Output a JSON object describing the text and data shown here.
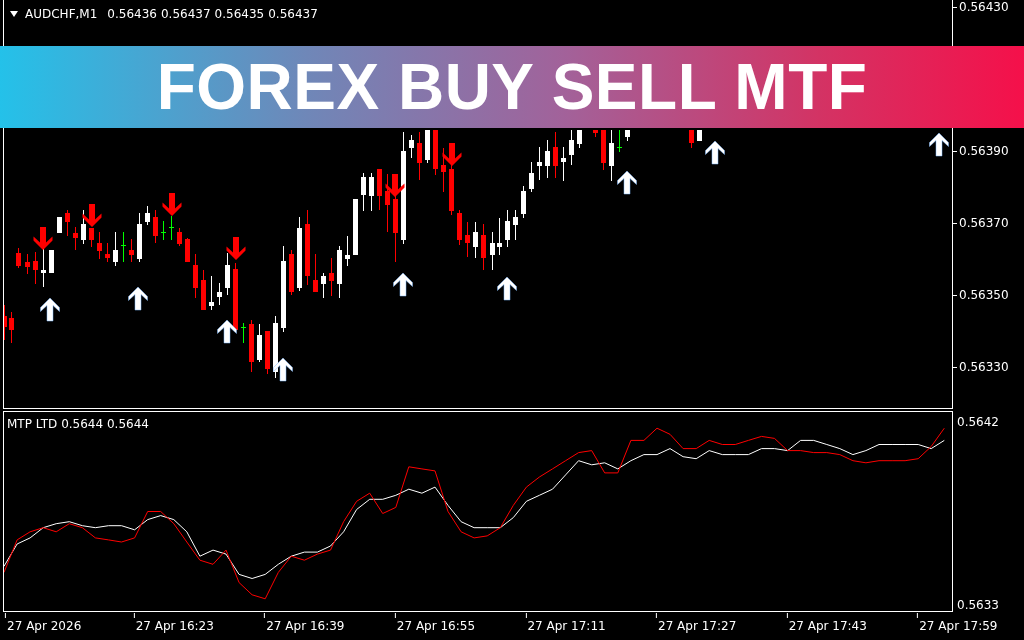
{
  "chart_header": {
    "symbol": "AUDCHF,M1",
    "quotes": [
      "0.56436",
      "0.56437",
      "0.56435",
      "0.56437"
    ]
  },
  "banner": {
    "title": "FOREX BUY SELL MTF"
  },
  "price_axis": {
    "labels": [
      "0.56430",
      "0.56390",
      "0.56370",
      "0.56350",
      "0.56330"
    ]
  },
  "indicator": {
    "chart_data": {
      "type": "line",
      "title": "MTP LTD 0.5644 0.5644",
      "categories": [
        null,
        null,
        null,
        "27 Apr 2026",
        null,
        null,
        null,
        null,
        null,
        null,
        null,
        null,
        null,
        "27 Apr 16:23",
        null,
        null,
        null,
        null,
        null,
        null,
        null,
        null,
        null,
        "27 Apr 16:39",
        null,
        null,
        null,
        null,
        null,
        null,
        null,
        null,
        null,
        "27 Apr 16:55",
        null,
        null,
        null,
        null,
        null,
        null,
        null,
        null,
        null,
        "27 Apr 17:11",
        null,
        null,
        null,
        null,
        null,
        null,
        null,
        null,
        null,
        "27 Apr 17:27",
        null,
        null,
        null,
        null,
        null,
        null,
        null,
        null,
        null,
        "27 Apr 17:43",
        null,
        null,
        null,
        null,
        null,
        null,
        null,
        null,
        null,
        "27 Apr 17:59"
      ],
      "ylim": [
        0.56327,
        0.56425
      ],
      "yticks": [
        {
          "value": 0.5642,
          "label": "0.5642"
        },
        {
          "value": 0.5633,
          "label": "0.5633"
        }
      ],
      "series": [
        {
          "color": "#ffffff",
          "values": [
            0.56349,
            0.5636,
            0.56363,
            0.56368,
            0.5637,
            0.56371,
            0.56369,
            0.56368,
            0.56369,
            0.56369,
            0.56367,
            0.56372,
            0.56374,
            0.56372,
            0.56366,
            0.56354,
            0.56357,
            0.56355,
            0.56345,
            0.56343,
            0.56345,
            0.5635,
            0.56354,
            0.56356,
            0.56356,
            0.56359,
            0.56366,
            0.56377,
            0.56382,
            0.56382,
            0.56384,
            0.56387,
            0.56385,
            0.56388,
            0.56379,
            0.56371,
            0.56368,
            0.56368,
            0.56368,
            0.56373,
            0.56381,
            0.56384,
            0.56387,
            0.56394,
            0.56401,
            0.56399,
            0.564,
            0.56397,
            0.56401,
            0.56404,
            0.56404,
            0.56407,
            0.56403,
            0.56402,
            0.56406,
            0.56404,
            0.56404,
            0.56404,
            0.56407,
            0.56407,
            0.56406,
            0.56411,
            0.56411,
            0.56409,
            0.56407,
            0.56404,
            0.56406,
            0.56409,
            0.56409,
            0.56409,
            0.56409,
            0.56407,
            0.56411,
            null
          ]
        },
        {
          "color": "#ff0000",
          "values": [
            0.56346,
            0.56362,
            0.56366,
            0.56368,
            0.56366,
            0.5637,
            0.56368,
            0.56363,
            0.56362,
            0.56361,
            0.56363,
            0.56376,
            0.56376,
            0.5637,
            0.56361,
            0.56352,
            0.5635,
            0.56357,
            0.56341,
            0.56335,
            0.56333,
            0.56346,
            0.56354,
            0.56352,
            0.56355,
            0.56357,
            0.56371,
            0.56381,
            0.56385,
            0.56375,
            0.56378,
            0.56398,
            0.56397,
            0.56396,
            0.56376,
            0.56366,
            0.56363,
            0.56364,
            0.56368,
            0.56379,
            0.56388,
            0.56393,
            0.56397,
            0.56401,
            0.56405,
            0.56406,
            0.56395,
            0.56395,
            0.56411,
            0.56411,
            0.56417,
            0.56414,
            0.56407,
            0.56407,
            0.56411,
            0.56409,
            0.56409,
            0.56411,
            0.56413,
            0.56412,
            0.56406,
            0.56406,
            0.56405,
            0.56405,
            0.56404,
            0.56401,
            0.564,
            0.56401,
            0.56401,
            0.56401,
            0.56402,
            0.56408,
            0.56417,
            null
          ]
        }
      ]
    }
  }
}
